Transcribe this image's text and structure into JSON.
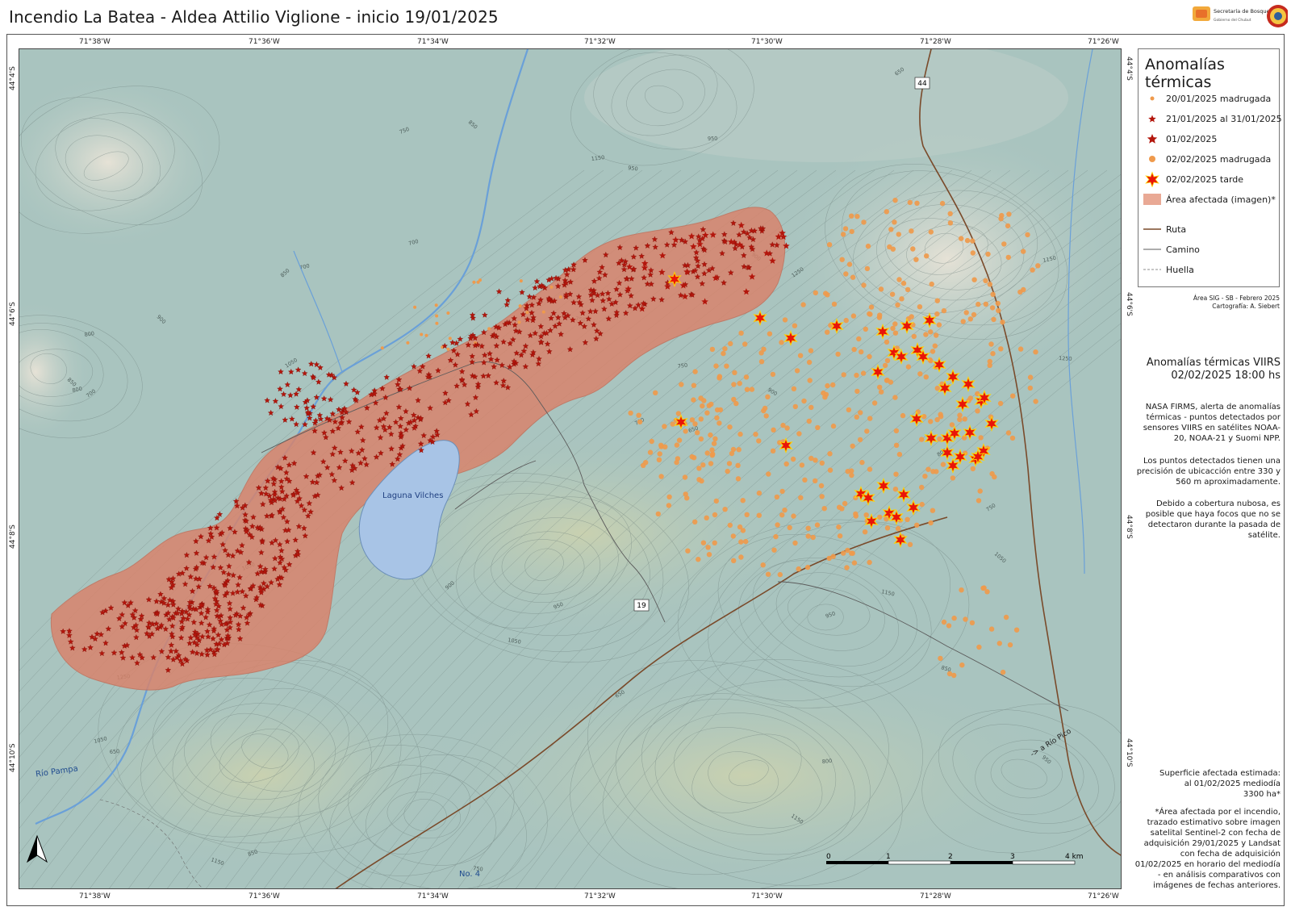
{
  "title": "Incendio La Batea - Aldea Attilio Viglione  -  inicio 19/01/2025",
  "logo": {
    "text": "Secretaría de Bosques",
    "subtext": "Gobierno del Chubut"
  },
  "coords": {
    "top": [
      "71°38'W",
      "71°36'W",
      "71°34'W",
      "71°32'W",
      "71°30'W",
      "71°28'W",
      "71°26'W"
    ],
    "bottom": [
      "71°38'W",
      "71°36'W",
      "71°34'W",
      "71°32'W",
      "71°30'W",
      "71°28'W",
      "71°26'W"
    ],
    "left": [
      "44°4'S",
      "44°6'S",
      "44°8'S",
      "44°10'S"
    ],
    "right": [
      "44°4'S",
      "44°6'S",
      "44°8'S",
      "44°10'S"
    ]
  },
  "legend": {
    "title": "Anomalías térmicas",
    "items": [
      {
        "label": "20/01/2025   madrugada",
        "symbol": "small-dot"
      },
      {
        "label": "21/01/2025 al 31/01/2025",
        "symbol": "small-star"
      },
      {
        "label": "01/02/2025",
        "symbol": "medium-star"
      },
      {
        "label": "02/02/2025   madrugada",
        "symbol": "medium-dot"
      },
      {
        "label": "02/02/2025   tarde",
        "symbol": "large-star"
      },
      {
        "label": "Área afectada (imagen)*",
        "symbol": "area-fill"
      },
      {
        "label": "Ruta",
        "symbol": "route-line"
      },
      {
        "label": "Camino",
        "symbol": "road-line"
      },
      {
        "label": "Huella",
        "symbol": "track-line"
      }
    ]
  },
  "credits": {
    "line1": "Área SIG - SB - Febrero 2025",
    "line2": "Cartografía: A. Siebert"
  },
  "side_panel": {
    "heading_line1": "Anomalías térmicas VIIRS",
    "heading_line2": "02/02/2025   18:00 hs",
    "para1": "NASA FIRMS, alerta de anomalías térmicas - puntos detectados por sensores VIIRS en satélites NOAA-20, NOAA-21 y Suomi NPP.",
    "para2": "Los puntos detectados tienen una precisión de ubicacción entre 330 y 560 m aproximadamente.",
    "para3": "Debido a cobertura nubosa, es posible que haya focos que no se detectaron durante la pasada de satélite.",
    "area_line1": "Superficie afectada estimada:",
    "area_line2": "al 01/02/2025 mediodía",
    "area_line3": "3300 ha*",
    "footnote": "*Área afectada por el incendio, trazado estimativo sobre imagen satelital Sentinel-2 con fecha de adquisición 29/01/2025 y Landsat con fecha de adquisición 01/02/2025 en horario del mediodía - en análisis comparativos con imágenes de fechas anteriores."
  },
  "map_labels": {
    "lake": "Laguna Vilches",
    "river": "Río Pampa",
    "road_19": "19",
    "road_44": "44",
    "to_rio_pico": "-> a Río Pico",
    "no4": "No. 4"
  },
  "scale": {
    "ticks": [
      "0",
      "1",
      "2",
      "3",
      "4 km"
    ]
  },
  "contour_labels": [
    "750",
    "850",
    "950",
    "1050",
    "1150",
    "1250",
    "650",
    "900",
    "800",
    "700"
  ],
  "colors": {
    "area_fill": "#d9826a",
    "star_dark": "#b3160c",
    "star_bright": "#e8140a",
    "dot_orange": "#ef9a4c",
    "lake": "#a8c4e6",
    "road": "#7a4a2a",
    "map_bg": "#a9c4bf"
  }
}
